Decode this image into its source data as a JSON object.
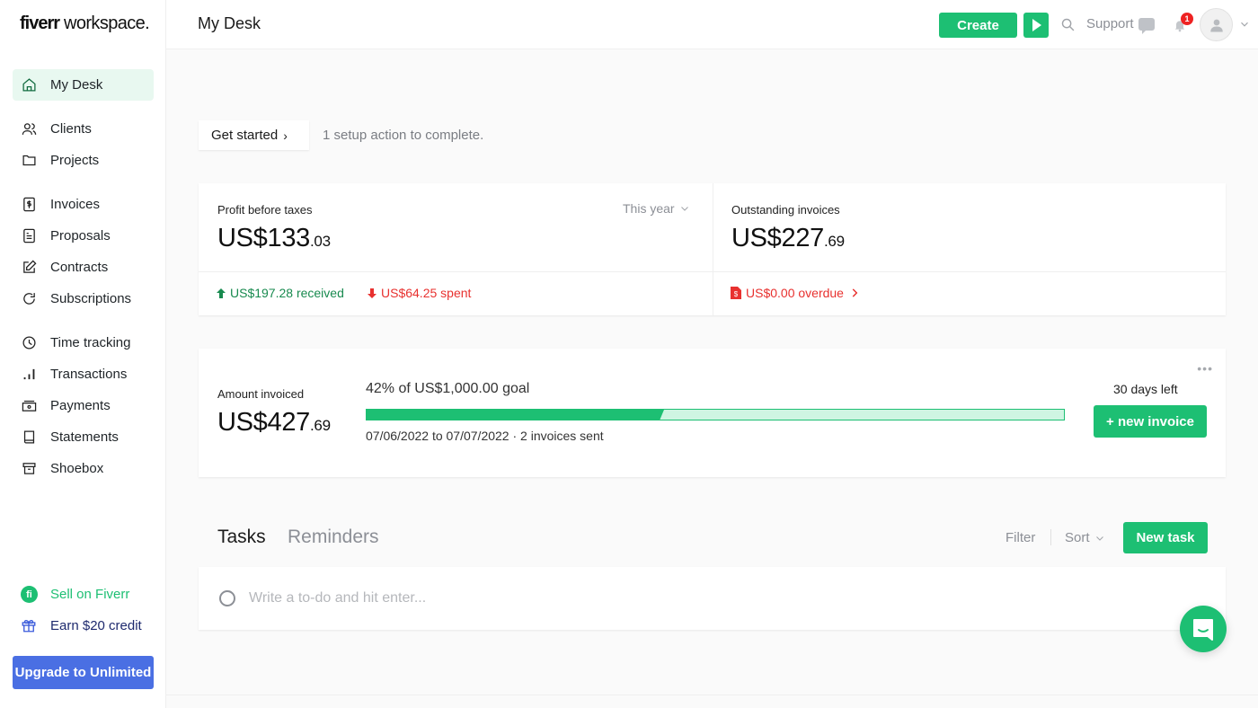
{
  "app": {
    "logo_bold": "fiverr",
    "logo_light": " workspace."
  },
  "header": {
    "title": "My Desk",
    "create_label": "Create",
    "support_label": "Support",
    "notification_count": "1"
  },
  "sidebar": {
    "items": [
      {
        "label": "My Desk",
        "icon": "home-icon",
        "active": true
      },
      {
        "label": "Clients",
        "icon": "users-icon"
      },
      {
        "label": "Projects",
        "icon": "folder-icon"
      },
      {
        "label": "Invoices",
        "icon": "invoice-dollar-icon"
      },
      {
        "label": "Proposals",
        "icon": "document-icon"
      },
      {
        "label": "Contracts",
        "icon": "edit-icon"
      },
      {
        "label": "Subscriptions",
        "icon": "refresh-icon"
      },
      {
        "label": "Time tracking",
        "icon": "clock-icon"
      },
      {
        "label": "Transactions",
        "icon": "bar-chart-icon"
      },
      {
        "label": "Payments",
        "icon": "cash-icon"
      },
      {
        "label": "Statements",
        "icon": "book-icon"
      },
      {
        "label": "Shoebox",
        "icon": "archive-box-icon"
      }
    ],
    "sell_label": "Sell on Fiverr",
    "sell_icon_text": "fi",
    "earn_label": "Earn $20 credit",
    "upgrade_label": "Upgrade to Unlimited"
  },
  "setup": {
    "button_label": "Get started",
    "message": "1 setup action to complete."
  },
  "profit": {
    "label": "Profit before taxes",
    "period": "This year",
    "amount_main": "US$133",
    "amount_cents": ".03",
    "received": "US$197.28 received",
    "spent": "US$64.25 spent"
  },
  "outstanding": {
    "label": "Outstanding invoices",
    "amount_main": "US$227",
    "amount_cents": ".69",
    "overdue": "US$0.00 overdue"
  },
  "goal": {
    "label": "Amount invoiced",
    "amount_main": "US$427",
    "amount_cents": ".69",
    "goal_text": "42% of US$1,000.00 goal",
    "progress_percent": 42,
    "range_text": "07/06/2022 to 07/07/2022 · 2 invoices sent",
    "days_left": "30 days left",
    "new_invoice_label": "+ new invoice",
    "more_label": "•••"
  },
  "tasks": {
    "tabs": [
      {
        "label": "Tasks",
        "active": true
      },
      {
        "label": "Reminders",
        "active": false
      }
    ],
    "filter_label": "Filter",
    "sort_label": "Sort",
    "new_task_label": "New task",
    "input_placeholder": "Write a to-do and hit enter..."
  },
  "colors": {
    "brand_green": "#1dbf73",
    "upgrade_blue": "#4a6fe3",
    "positive": "#188a4f",
    "negative": "#e8312f"
  }
}
